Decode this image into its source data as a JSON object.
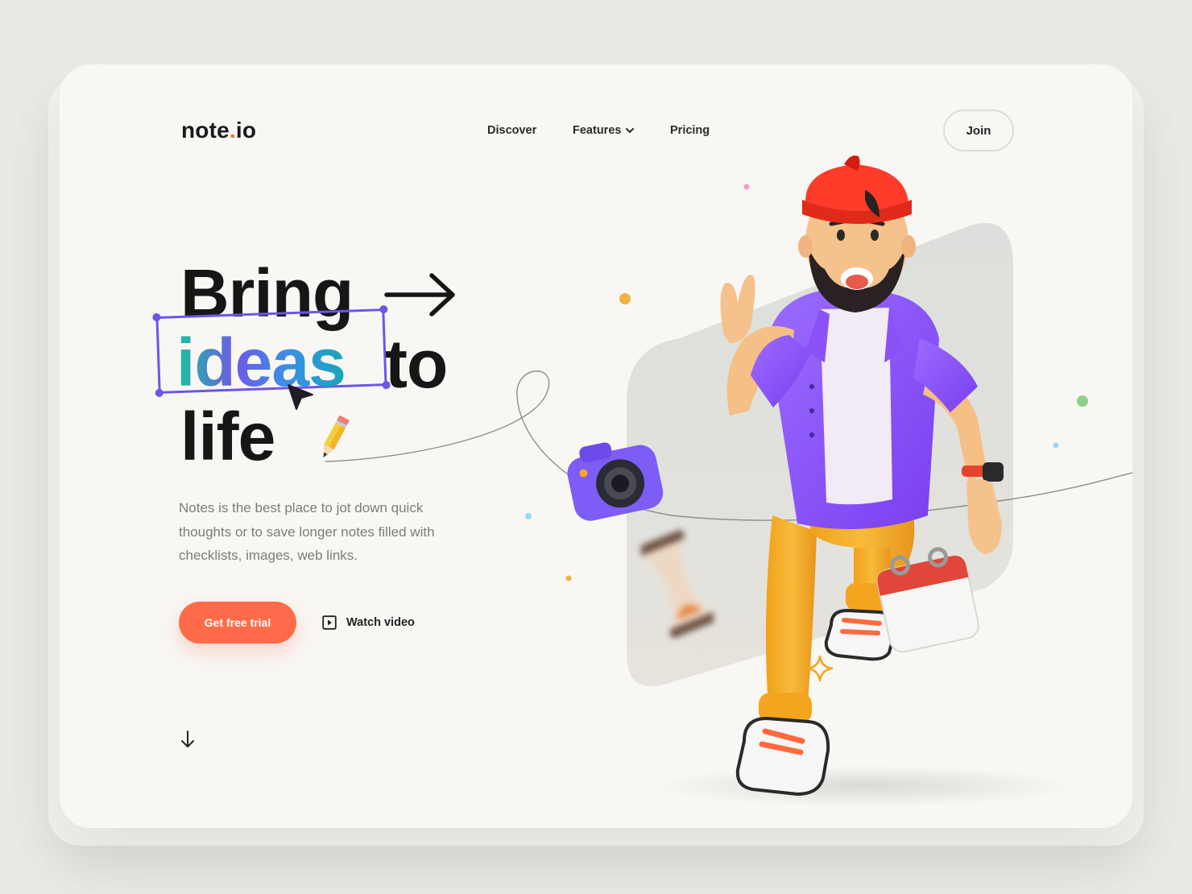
{
  "brand": {
    "name": "note",
    "dot": ".",
    "suffix": "io"
  },
  "nav": {
    "items": [
      "Discover",
      "Features",
      "Pricing"
    ],
    "join_label": "Join"
  },
  "hero": {
    "headline": {
      "word1": "Bring",
      "highlight": "ideas",
      "word2": "to",
      "word3": "life"
    },
    "description": "Notes is the best place to jot down quick thoughts or to save longer notes filled with checklists, images, web links.",
    "cta_label": "Get free trial",
    "watch_label": "Watch video"
  },
  "colors": {
    "accent": "#ff6b4a",
    "selection": "#6b56e8",
    "text": "#161616",
    "muted": "#7c7c7a",
    "background": "#f8f7f4"
  },
  "icons": [
    "chevron-down-icon",
    "arrow-right-icon",
    "cursor-icon",
    "pencil-icon",
    "play-icon",
    "arrow-down-icon",
    "camera-icon",
    "calendar-icon",
    "hourglass-icon",
    "sparkle-icon"
  ]
}
